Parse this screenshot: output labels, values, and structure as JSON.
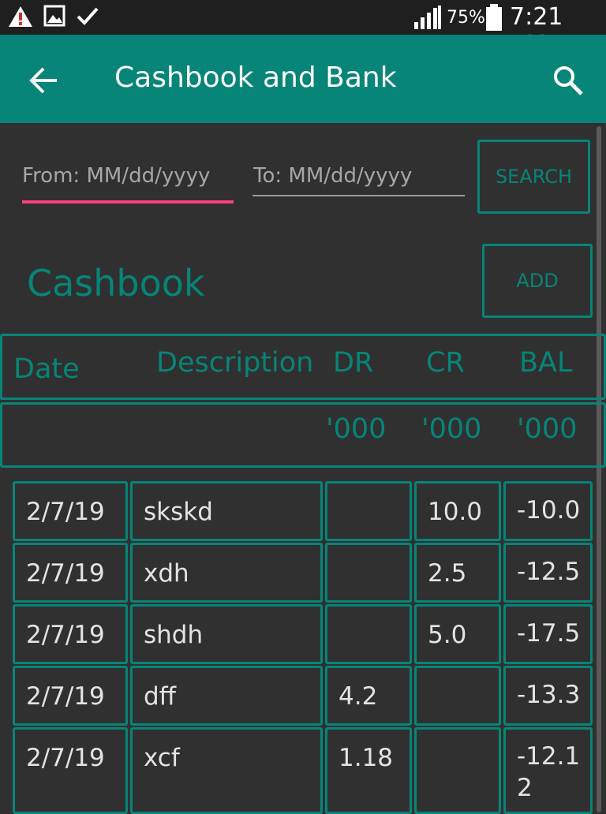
{
  "status_bar": {
    "battery": "75%",
    "time": "7:21 AM",
    "icons": [
      "warning-icon",
      "image-icon",
      "check-icon",
      "signal-icon",
      "battery-icon"
    ]
  },
  "app_bar": {
    "title": "Cashbook and Bank",
    "back_icon": "arrow-left-icon",
    "search_icon": "search-icon"
  },
  "filters": {
    "from_placeholder": "From: MM/dd/yyyy",
    "to_placeholder": "To: MM/dd/yyyy",
    "search_label": "SEARCH"
  },
  "cashbook": {
    "title": "Cashbook",
    "add_label": "ADD"
  },
  "table": {
    "headers": {
      "date": "Date",
      "description": "Description",
      "dr": "DR",
      "cr": "CR",
      "bal": "BAL"
    },
    "units": {
      "dr": "'000",
      "cr": "'000",
      "bal": "'000"
    },
    "rows": [
      {
        "date": "2/7/19",
        "description": "skskd",
        "dr": "",
        "cr": "10.0",
        "bal": "-10.0"
      },
      {
        "date": "2/7/19",
        "description": "xdh",
        "dr": "",
        "cr": "2.5",
        "bal": "-12.5"
      },
      {
        "date": "2/7/19",
        "description": "shdh",
        "dr": "",
        "cr": "5.0",
        "bal": "-17.5"
      },
      {
        "date": "2/7/19",
        "description": "dff",
        "dr": "4.2",
        "cr": "",
        "bal": "-13.3"
      },
      {
        "date": "2/7/19",
        "description": "xcf",
        "dr": "1.18",
        "cr": "",
        "bal": "-12.12"
      }
    ]
  },
  "colors": {
    "accent": "#068578",
    "background": "#303030",
    "focus_underline": "#ff4081",
    "status_bar": "#1f1f1f"
  }
}
